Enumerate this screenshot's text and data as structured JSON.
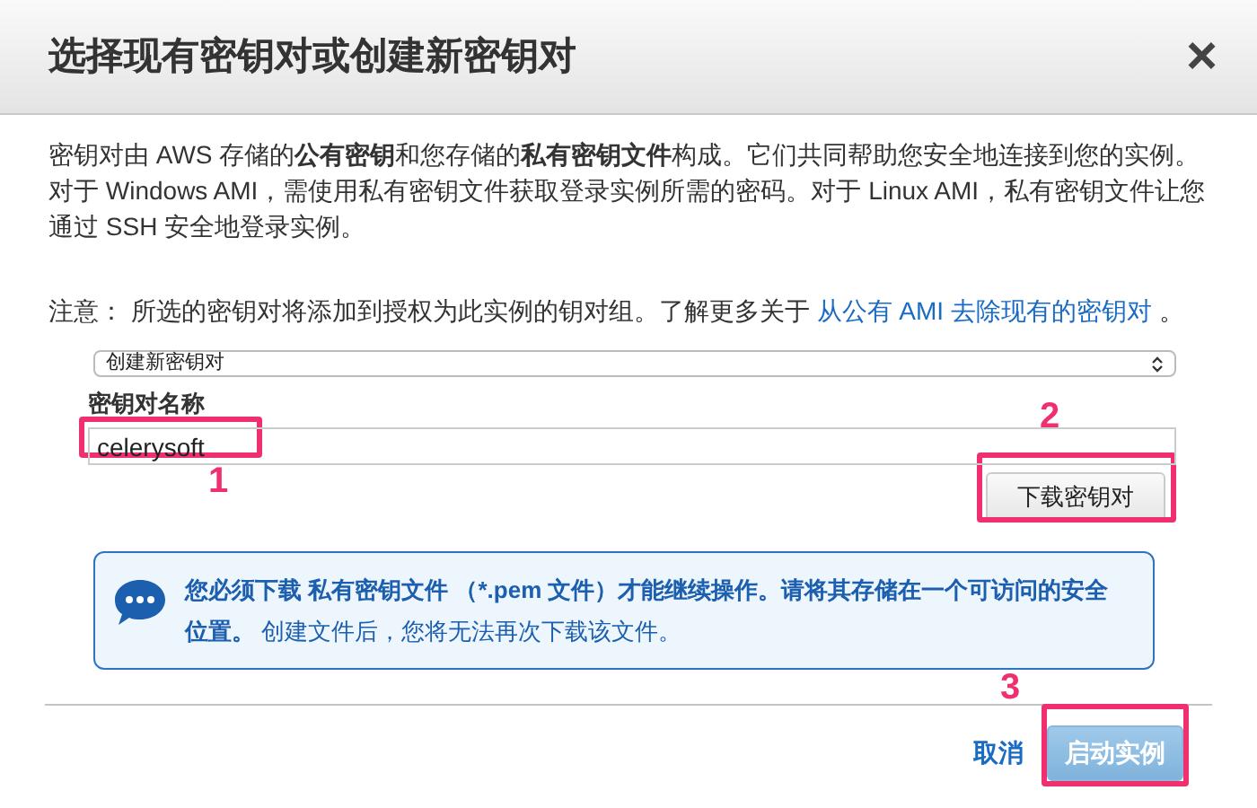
{
  "dialog": {
    "title": "选择现有密钥对或创建新密钥对",
    "close": "×"
  },
  "description": "密钥对由 AWS 存储的**公有密钥**和您存储的**私有密钥文件**构成。它们共同帮助您安全地连接到您的实例。对于 Windows AMI，需使用私有密钥文件获取登录实例所需的密码。对于 Linux AMI，私有密钥文件让您通过 SSH 安全地登录实例。",
  "note": {
    "label": "注意：",
    "text": "所选的密钥对将添加到授权为此实例的钥对组。了解更多关于",
    "link": "从公有 AMI 去除现有的密钥对",
    "end": "。"
  },
  "key_pair_option": {
    "value": "创建新密钥对"
  },
  "key_pair_name": {
    "label": "密钥对名称",
    "value": "celerysoft"
  },
  "download_button": "下载密钥对",
  "message": {
    "strong": "您必须下载 私有密钥文件 （*.pem 文件）才能继续操作。请将其存储在一个可访问的安全位置。",
    "rest": "创建文件后，您将无法再次下载该文件。"
  },
  "footer": {
    "cancel": "取消",
    "launch": "启动实例"
  },
  "annotations": [
    {
      "label": "1"
    },
    {
      "label": "2"
    },
    {
      "label": "3"
    }
  ]
}
